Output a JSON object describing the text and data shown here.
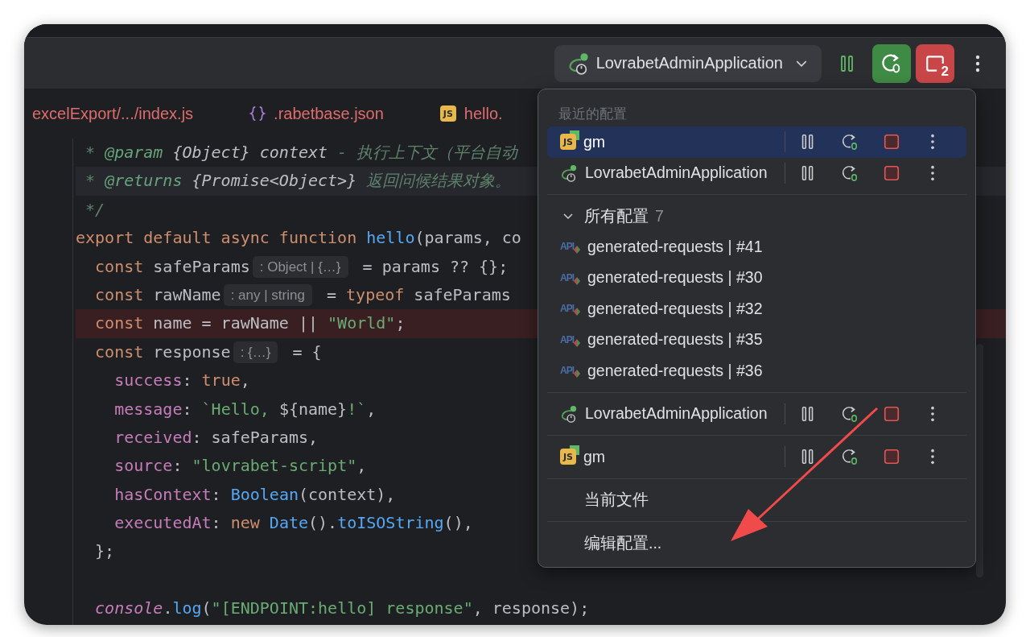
{
  "toolbar": {
    "config": {
      "name": "LovrabetAdminApplication",
      "icon": {
        "kind": "app"
      }
    },
    "stop_count": "2"
  },
  "tabs": [
    {
      "label": "excelExport/.../index.js"
    },
    {
      "label": ".rabetbase.json",
      "icon": {
        "kind": "json"
      }
    },
    {
      "label": "hello.",
      "icon": {
        "kind": "js",
        "text": "JS"
      }
    }
  ],
  "code": [
    {
      "segments": [
        {
          "text": " * ",
          "kind": "doc"
        },
        {
          "text": "@param",
          "kind": "doctag"
        },
        {
          "text": " {Object} context",
          "kind": "doctype"
        },
        {
          "text": " - 执行上下文（平台自动",
          "kind": "doc"
        }
      ]
    },
    {
      "current": true,
      "segments": [
        {
          "text": " * ",
          "kind": "doc"
        },
        {
          "text": "@returns",
          "kind": "doctag"
        },
        {
          "text": " {Promise<Object>}",
          "kind": "doctype"
        },
        {
          "text": " 返回问候结果对象。",
          "kind": "doc"
        }
      ]
    },
    {
      "segments": [
        {
          "text": " */",
          "kind": "doc"
        }
      ]
    },
    {
      "segments": [
        {
          "text": "export default async function ",
          "kind": "kw"
        },
        {
          "text": "hello",
          "kind": "fn"
        },
        {
          "text": "(params, co",
          "kind": "id"
        }
      ]
    },
    {
      "segments": [
        {
          "text": "  const ",
          "kind": "kw"
        },
        {
          "text": "safeParams",
          "kind": "id"
        },
        {
          "text": ": Object | {…}",
          "kind": "hint"
        },
        {
          "text": " = params ?? {};",
          "kind": "id"
        }
      ]
    },
    {
      "segments": [
        {
          "text": "  const ",
          "kind": "kw"
        },
        {
          "text": "rawName",
          "kind": "id"
        },
        {
          "text": ": any | string",
          "kind": "hint"
        },
        {
          "text": " = ",
          "kind": "id"
        },
        {
          "text": "typeof ",
          "kind": "kw"
        },
        {
          "text": "safeParams",
          "kind": "id"
        }
      ]
    },
    {
      "error": true,
      "segments": [
        {
          "text": "  const ",
          "kind": "kw"
        },
        {
          "text": "name = rawName || ",
          "kind": "id"
        },
        {
          "text": "\"World\"",
          "kind": "str"
        },
        {
          "text": ";",
          "kind": "id"
        }
      ]
    },
    {
      "segments": [
        {
          "text": "  const ",
          "kind": "kw"
        },
        {
          "text": "response",
          "kind": "id"
        },
        {
          "text": ": {…}",
          "kind": "hint"
        },
        {
          "text": " = {",
          "kind": "id"
        }
      ]
    },
    {
      "segments": [
        {
          "text": "    success",
          "kind": "prop"
        },
        {
          "text": ": ",
          "kind": "id"
        },
        {
          "text": "true",
          "kind": "kw"
        },
        {
          "text": ",",
          "kind": "id"
        }
      ]
    },
    {
      "segments": [
        {
          "text": "    message",
          "kind": "prop"
        },
        {
          "text": ": ",
          "kind": "id"
        },
        {
          "text": "`Hello, ",
          "kind": "str"
        },
        {
          "text": "${name}",
          "kind": "id"
        },
        {
          "text": "!`",
          "kind": "str"
        },
        {
          "text": ",",
          "kind": "id"
        }
      ]
    },
    {
      "segments": [
        {
          "text": "    received",
          "kind": "prop"
        },
        {
          "text": ": safeParams,",
          "kind": "id"
        }
      ]
    },
    {
      "segments": [
        {
          "text": "    source",
          "kind": "prop"
        },
        {
          "text": ": ",
          "kind": "id"
        },
        {
          "text": "\"lovrabet-script\"",
          "kind": "str"
        },
        {
          "text": ",",
          "kind": "id"
        }
      ]
    },
    {
      "segments": [
        {
          "text": "    hasContext",
          "kind": "prop"
        },
        {
          "text": ": ",
          "kind": "id"
        },
        {
          "text": "Boolean",
          "kind": "fn"
        },
        {
          "text": "(context),",
          "kind": "id"
        }
      ]
    },
    {
      "segments": [
        {
          "text": "    executedAt",
          "kind": "prop"
        },
        {
          "text": ": ",
          "kind": "id"
        },
        {
          "text": "new ",
          "kind": "kw"
        },
        {
          "text": "Date",
          "kind": "fn"
        },
        {
          "text": "().",
          "kind": "id"
        },
        {
          "text": "toISOString",
          "kind": "fn"
        },
        {
          "text": "(),",
          "kind": "id"
        }
      ]
    },
    {
      "segments": [
        {
          "text": "  };",
          "kind": "id"
        }
      ]
    },
    {
      "blank": true
    },
    {
      "segments": [
        {
          "text": "  console",
          "kind": "global"
        },
        {
          "text": ".",
          "kind": "id"
        },
        {
          "text": "log",
          "kind": "fn"
        },
        {
          "text": "(",
          "kind": "id"
        },
        {
          "text": "\"[ENDPOINT:hello] response\"",
          "kind": "str"
        },
        {
          "text": ", response);",
          "kind": "id"
        }
      ]
    }
  ],
  "popup": {
    "recent_title": "最近的配置",
    "recent": [
      {
        "name": "gm",
        "icon": {
          "kind": "js",
          "text": "JS"
        },
        "selected": true
      },
      {
        "name": "LovrabetAdminApplication",
        "icon": {
          "kind": "app"
        },
        "selected": false
      }
    ],
    "all": {
      "title": "所有配置",
      "count": "7",
      "expanded": true,
      "items": [
        {
          "name": "generated-requests | #41",
          "icon": {
            "kind": "api",
            "text": "API"
          }
        },
        {
          "name": "generated-requests | #30",
          "icon": {
            "kind": "api",
            "text": "API"
          }
        },
        {
          "name": "generated-requests | #32",
          "icon": {
            "kind": "api",
            "text": "API"
          }
        },
        {
          "name": "generated-requests | #35",
          "icon": {
            "kind": "api",
            "text": "API"
          }
        },
        {
          "name": "generated-requests | #36",
          "icon": {
            "kind": "api",
            "text": "API"
          }
        }
      ]
    },
    "running": [
      {
        "name": "LovrabetAdminApplication",
        "icon": {
          "kind": "app"
        },
        "selected": false
      },
      {
        "name": "gm",
        "icon": {
          "kind": "js",
          "text": "JS"
        },
        "selected": false
      }
    ],
    "actions": [
      "当前文件",
      "编辑配置..."
    ]
  }
}
